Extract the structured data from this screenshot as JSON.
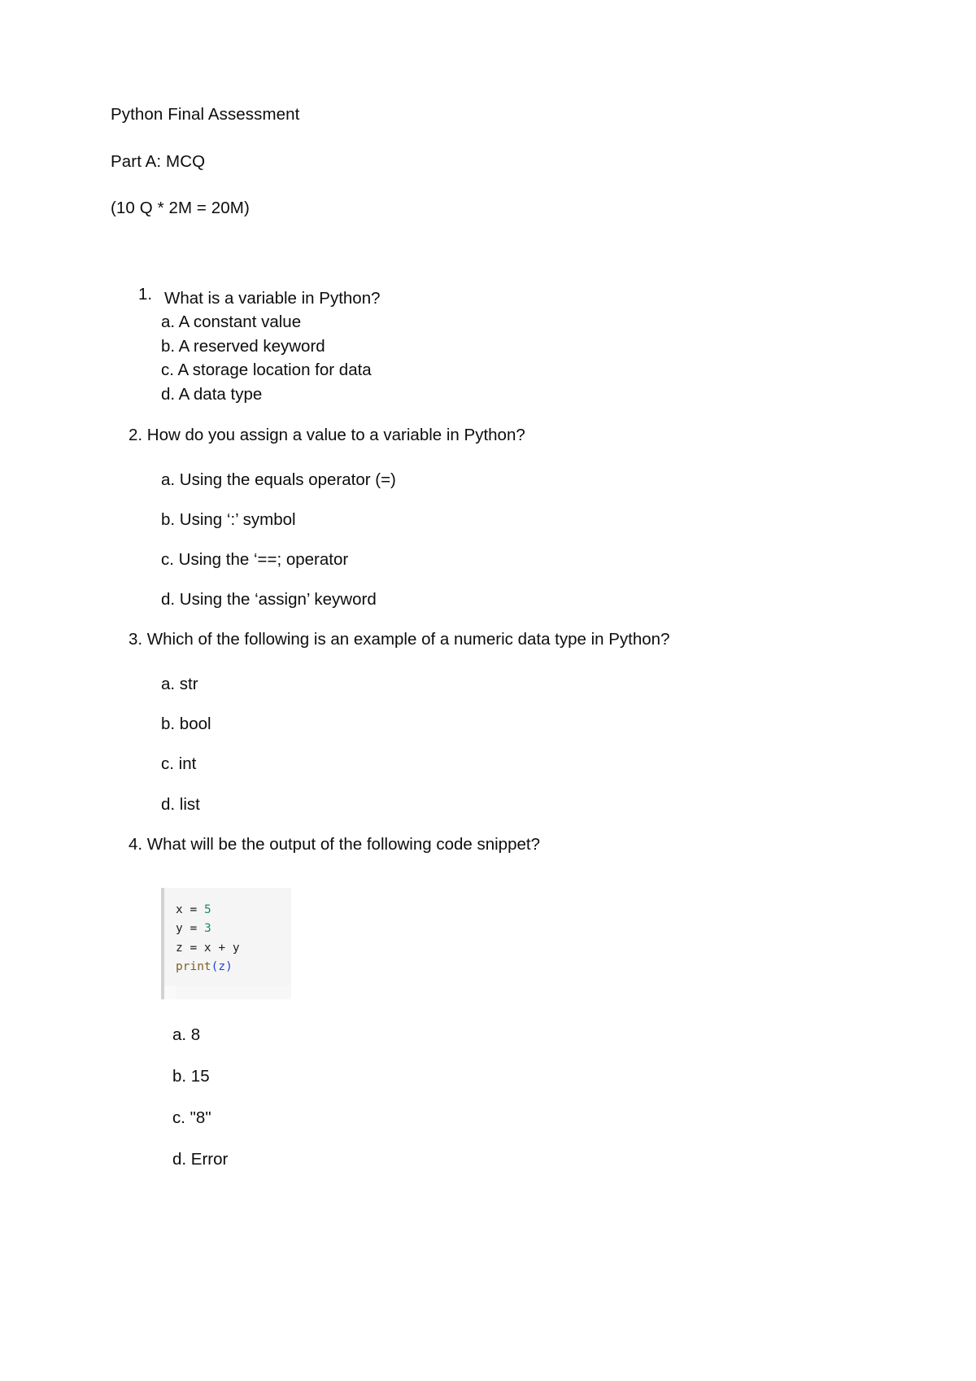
{
  "document": {
    "title": "Python Final Assessment",
    "part_label": "Part A: MCQ",
    "marks_line": "(10 Q * 2M = 20M)"
  },
  "questions": [
    {
      "number": "1.",
      "text": "What is a variable in Python?",
      "options": [
        "a. A constant value",
        "b. A reserved keyword",
        "c. A storage location for data",
        "d. A data type"
      ]
    },
    {
      "number": "2.",
      "text": "2. How do you assign a value to a variable in Python?",
      "options": [
        "a. Using the equals operator (=)",
        "b. Using ‘:’ symbol",
        "c. Using the ‘==; operator",
        "d. Using the ‘assign’ keyword"
      ]
    },
    {
      "number": "3.",
      "text": "3. Which of the following is an example of a numeric data type in Python?",
      "options": [
        "a. str",
        "b. bool",
        "c. int",
        "d. list"
      ]
    },
    {
      "number": "4.",
      "text": "4. What will be the output of the following code snippet?",
      "options": [
        "a. 8",
        "b. 15",
        "c. \"8\"",
        "d. Error"
      ]
    }
  ],
  "code_snippet": {
    "language": "python",
    "line1": {
      "var": "x",
      "op": " = ",
      "num": "5"
    },
    "line2": {
      "var": "y",
      "op": " = ",
      "num": "3"
    },
    "line3": {
      "text": "z = x + y"
    },
    "line4": {
      "fn": "print",
      "open": "(",
      "arg": "z",
      "close": ")"
    },
    "colors": {
      "background": "#f5f5f5",
      "accent_bar": "#d2d2d2",
      "number": "#1a8a74",
      "function": "#7d6023",
      "paren": "#1f43d6",
      "text": "#1c1c1c"
    }
  }
}
